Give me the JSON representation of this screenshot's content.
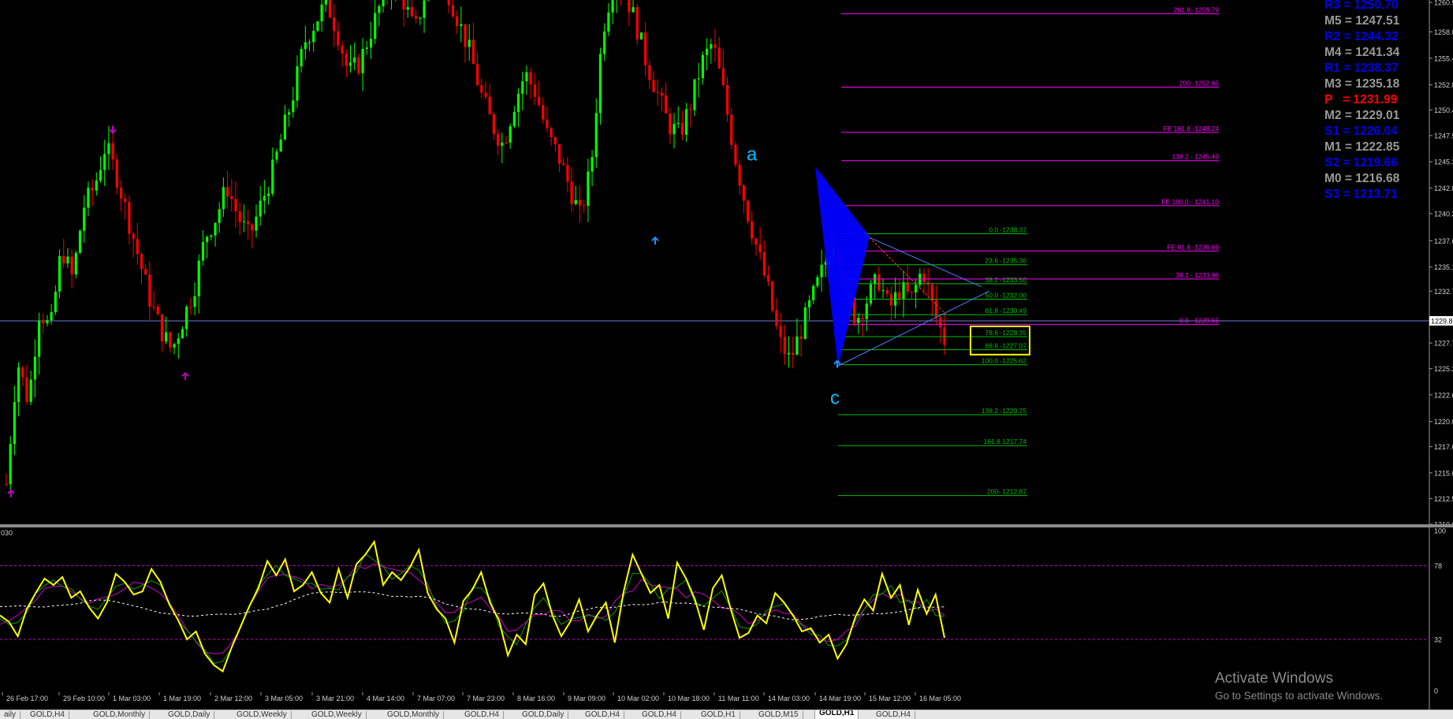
{
  "chart_data": [
    {
      "type": "candlestick",
      "symbol": "GOLD",
      "timeframe": "H1",
      "ylim": [
        1210.08,
        1260.9
      ],
      "grid": false,
      "price_ticks": [
        "1260.9",
        "1258.03",
        "1255.46",
        "1252.86",
        "1250.43",
        "1247.93",
        "1245.38",
        "1242.83",
        "1240.33",
        "1237.69",
        "1235.13",
        "1232.78",
        "1229.89",
        "1227.73",
        "1225.23",
        "1222.68",
        "1220.08",
        "1217.63",
        "1215.08",
        "1212.58",
        "1210.08"
      ],
      "current_price": "1229.89",
      "x_ticks": [
        "26 Feb 17:00",
        "29 Feb 10:00",
        "1 Mar 03:00",
        "1 Mar 19:00",
        "2 Mar 12:00",
        "3 Mar 05:00",
        "3 Mar 21:00",
        "4 Mar 14:00",
        "7 Mar 07:00",
        "7 Mar 23:00",
        "8 Mar 16:00",
        "9 Mar 09:00",
        "10 Mar 02:00",
        "10 Mar 18:00",
        "11 Mar 11:00",
        "14 Mar 03:00",
        "14 Mar 19:00",
        "15 Mar 12:00",
        "16 Mar 05:00"
      ],
      "price_path": [
        1214,
        1226,
        1222,
        1231,
        1229,
        1237,
        1234,
        1241,
        1243,
        1247,
        1244,
        1240,
        1236,
        1232,
        1229,
        1227,
        1230,
        1233,
        1238,
        1240,
        1243,
        1240,
        1238,
        1241,
        1244,
        1248,
        1252,
        1257,
        1259,
        1261,
        1258,
        1254,
        1255,
        1258,
        1261,
        1263,
        1261,
        1258,
        1262,
        1264,
        1262,
        1259,
        1256,
        1252,
        1249,
        1247,
        1251,
        1254,
        1252,
        1248,
        1246,
        1243,
        1240,
        1245,
        1258,
        1263,
        1262,
        1259,
        1255,
        1252,
        1249,
        1248,
        1251,
        1255,
        1257,
        1252,
        1246,
        1241,
        1237,
        1233,
        1228,
        1226,
        1229,
        1232,
        1235,
        1238,
        1233,
        1230,
        1232,
        1234,
        1231,
        1233,
        1232,
        1235,
        1231,
        1228
      ],
      "arrows": [
        {
          "dir": "down",
          "price": 1248.2,
          "color": "#c000c0"
        },
        {
          "dir": "up",
          "price": 1224.8,
          "color": "#c000c0"
        },
        {
          "dir": "up",
          "price": 1213.4,
          "color": "#c000c0"
        },
        {
          "dir": "up",
          "price": 1238.0,
          "color": "#1e90ff"
        },
        {
          "dir": "up",
          "price": 1226.0,
          "color": "#1e90ff"
        }
      ],
      "wave_labels": [
        {
          "text": "a",
          "price": 1245.5
        },
        {
          "text": "c",
          "price": 1221.8
        }
      ],
      "fib_magenta": [
        {
          "label": "261.8 -1259.79",
          "price": 1259.79
        },
        {
          "label": "200 -1252.65",
          "price": 1252.65
        },
        {
          "label": "FE 161.8 -1248.24",
          "price": 1248.24
        },
        {
          "label": "138.2 - 1245.49",
          "price": 1245.49
        },
        {
          "label": "FE 100.0 - 1241.10",
          "price": 1241.1
        },
        {
          "label": "FE 61.8 -1236.69",
          "price": 1236.69
        },
        {
          "label": "38.2 - 1233.96",
          "price": 1233.96
        },
        {
          "label": "0.0 - 1229.55",
          "price": 1229.55
        }
      ],
      "fib_green": [
        {
          "label": "0.0 -1238.37",
          "price": 1238.37
        },
        {
          "label": "23.6 -1235.36",
          "price": 1235.36
        },
        {
          "label": "38.2 -1233.50",
          "price": 1233.5
        },
        {
          "label": "50.0 -1232.00",
          "price": 1232.0
        },
        {
          "label": "61.8 -1230.49",
          "price": 1230.49
        },
        {
          "label": "78.6 -1228.35",
          "price": 1228.35
        },
        {
          "label": "88.6 -1227.07",
          "price": 1227.07
        },
        {
          "label": "100.0 -1225.62",
          "price": 1225.62
        },
        {
          "label": "138.2 -1220.75",
          "price": 1220.75
        },
        {
          "label": "161.8 1217.74",
          "price": 1217.74
        },
        {
          "label": "200- 1212.87",
          "price": 1212.87
        }
      ]
    },
    {
      "type": "line",
      "name": "oscillator",
      "ylim": [
        0,
        100
      ],
      "y_ticks": [
        "100",
        "78",
        "32",
        "0"
      ],
      "levels": [
        78,
        32
      ],
      "values": [
        47,
        43,
        34,
        51,
        61,
        70,
        66,
        71,
        58,
        62,
        52,
        45,
        55,
        73,
        68,
        60,
        62,
        76,
        68,
        54,
        44,
        32,
        37,
        23,
        16,
        12,
        27,
        40,
        53,
        64,
        81,
        72,
        82,
        62,
        66,
        74,
        61,
        55,
        76,
        58,
        79,
        85,
        93,
        66,
        74,
        69,
        77,
        88,
        61,
        51,
        45,
        30,
        56,
        63,
        74,
        55,
        44,
        22,
        35,
        29,
        60,
        67,
        47,
        34,
        43,
        57,
        37,
        47,
        55,
        30,
        62,
        85,
        73,
        61,
        66,
        45,
        80,
        70,
        57,
        38,
        64,
        72,
        51,
        33,
        36,
        47,
        42,
        61,
        55,
        47,
        37,
        39,
        30,
        35,
        20,
        29,
        46,
        57,
        50,
        73,
        58,
        66,
        41,
        63,
        48,
        60,
        33
      ]
    }
  ],
  "top_left_label": "030",
  "pivots": [
    {
      "text": "R3 = 1250.70",
      "color": "#0000ee"
    },
    {
      "text": "M5 = 1247.51",
      "color": "#999999"
    },
    {
      "text": "R2 = 1244.32",
      "color": "#0000ee"
    },
    {
      "text": "M4 = 1241.34",
      "color": "#999999"
    },
    {
      "text": "R1 = 1238.37",
      "color": "#0000ee"
    },
    {
      "text": "M3 = 1235.18",
      "color": "#999999"
    },
    {
      "text": "P   = 1231.99",
      "color": "#ff0000"
    },
    {
      "text": "M2 = 1229.01",
      "color": "#999999"
    },
    {
      "text": "S1 = 1226.04",
      "color": "#0000ee"
    },
    {
      "text": "M1 = 1222.85",
      "color": "#999999"
    },
    {
      "text": "S2 = 1219.66",
      "color": "#0000ee"
    },
    {
      "text": "M0 = 1216.68",
      "color": "#999999"
    },
    {
      "text": "S3 = 1213.71",
      "color": "#0000ee"
    }
  ],
  "watermark": {
    "title": "Activate Windows",
    "subtitle": "Go to Settings to activate Windows."
  },
  "tabs": [
    "aily",
    "GOLD,H4",
    "GOLD,Monthly",
    "GOLD,Daily",
    "GOLD,Weekly",
    "GOLD,Weekly",
    "GOLD,Monthly",
    "GOLD,H4",
    "GOLD,Daily",
    "GOLD,H4",
    "GOLD,H4",
    "GOLD,H1",
    "GOLD,M15",
    "GOLD,H1",
    "GOLD,H4"
  ],
  "active_tab": "GOLD,H1",
  "colors": {
    "bull": "#00ff00",
    "bear": "#ff0000",
    "osc": "#ffff00",
    "fib_magenta": "#ff00ff",
    "fib_green": "#00c000",
    "triangle": "#0000ff",
    "price_line": "#6b7bd6",
    "box": "#ffff00",
    "wave_label": "#00bfff"
  }
}
